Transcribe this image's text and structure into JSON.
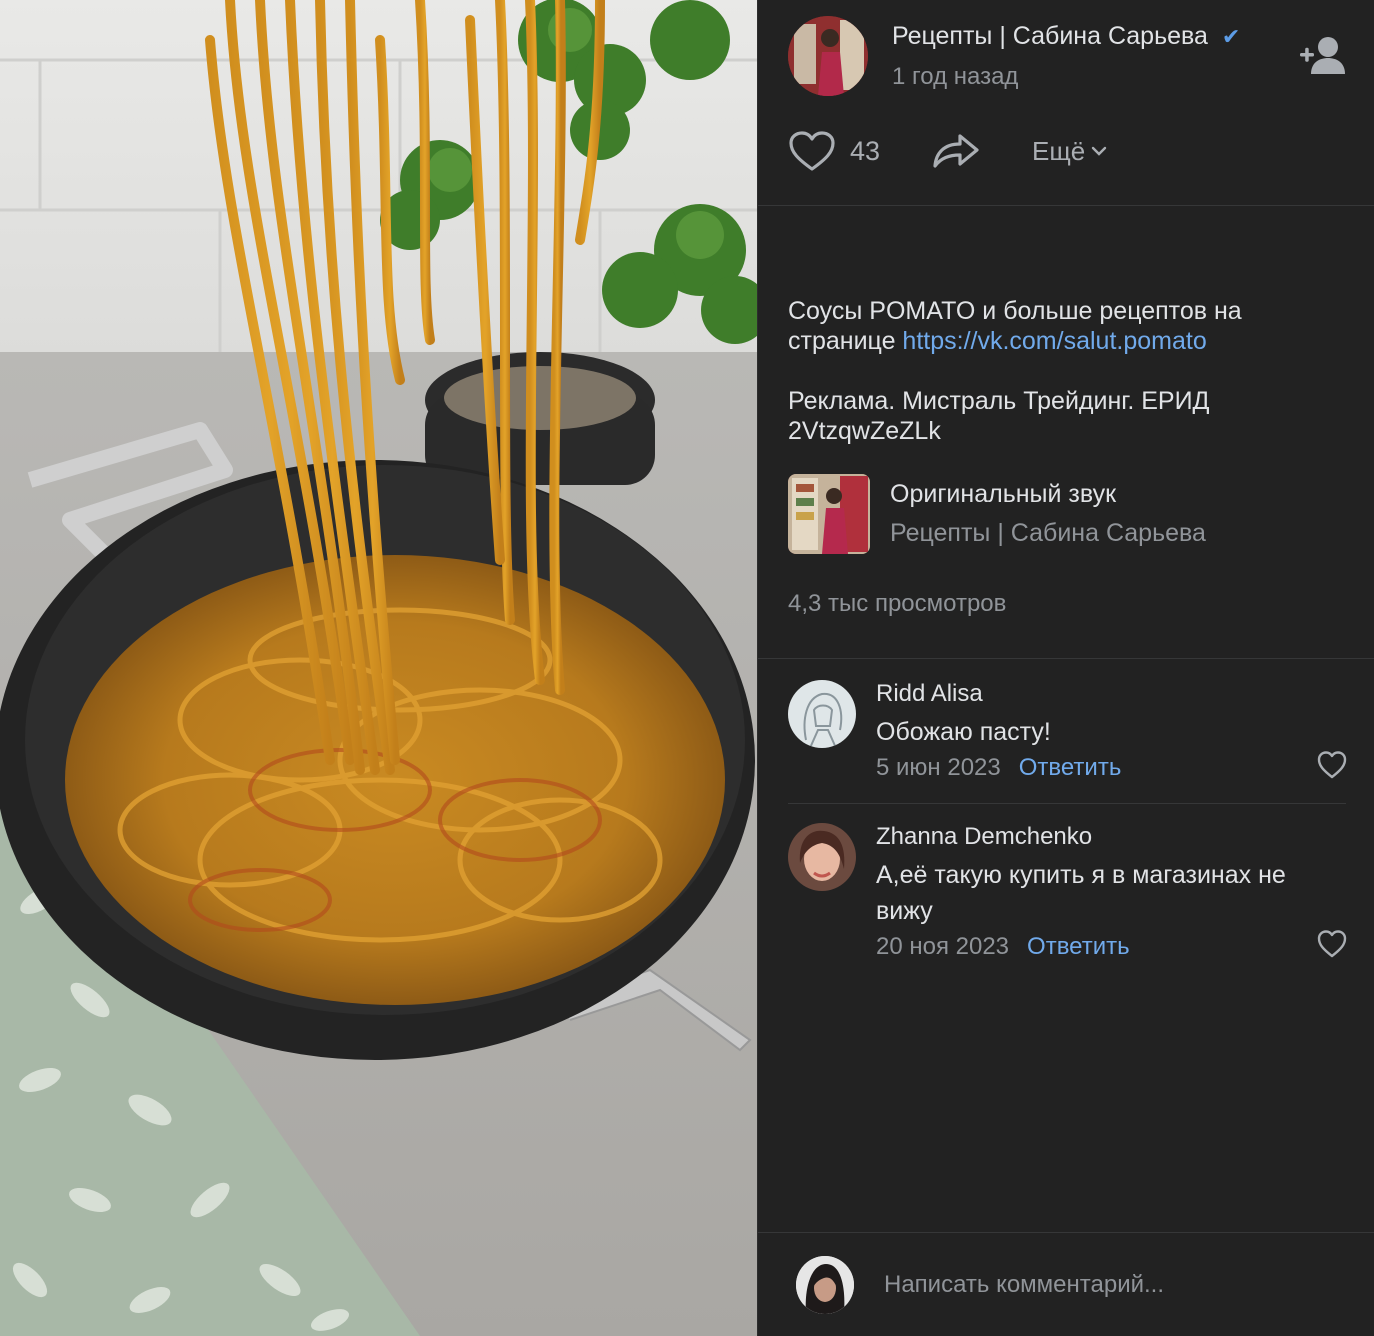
{
  "author": {
    "name": "Рецепты | Сабина Сарьева",
    "time": "1 год назад",
    "verified_icon": "check-icon"
  },
  "actions": {
    "likes": "43",
    "more_label": "Ещё"
  },
  "description": {
    "line1_text": "Соусы POMATO и больше рецептов на странице ",
    "link": "https://vk.com/salut.pomato",
    "line2": "Реклама. Мистраль Трейдинг. ЕРИД 2VtzqwZeZLk"
  },
  "sound": {
    "title": "Оригинальный звук",
    "author": "Рецепты | Сабина Сарьева"
  },
  "views": "4,3 тыс просмотров",
  "comments": [
    {
      "name": "Ridd Alisa",
      "text": "Обожаю пасту!",
      "date": "5 июн 2023",
      "reply": "Ответить"
    },
    {
      "name": "Zhanna Demchenko",
      "text": "А,её такую купить я в магазинах не вижу",
      "date": "20 ноя 2023",
      "reply": "Ответить"
    }
  ],
  "compose": {
    "placeholder": "Написать комментарий..."
  },
  "colors": {
    "panel_bg": "#222222",
    "link": "#71aaeb",
    "muted": "#909499"
  }
}
